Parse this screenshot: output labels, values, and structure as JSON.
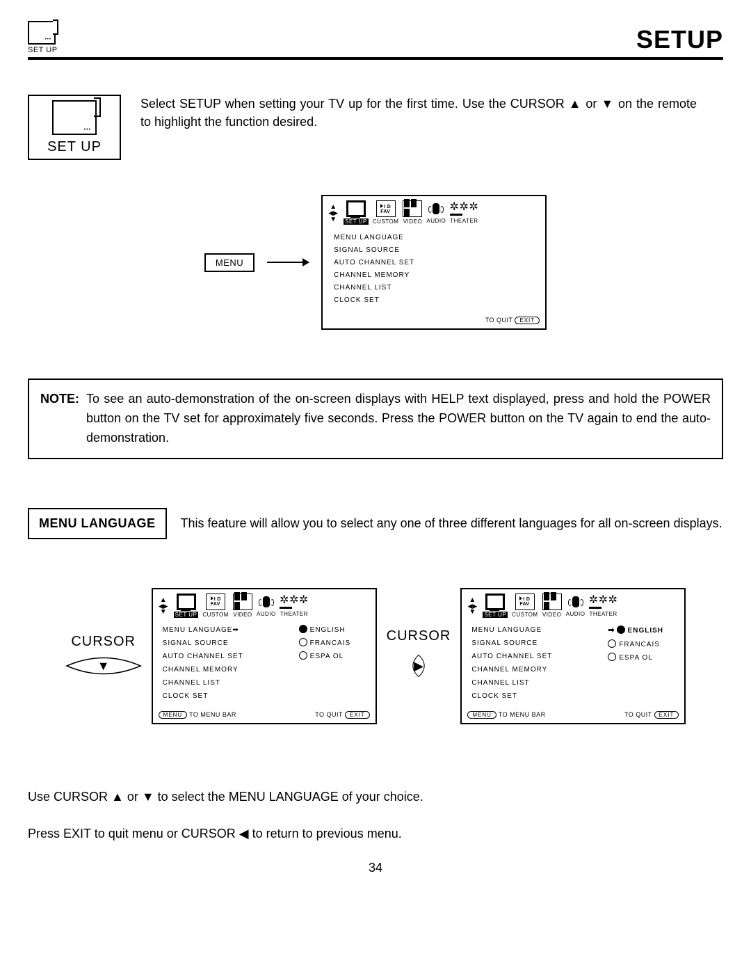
{
  "header": {
    "icon_caption": "SET UP",
    "title": "SETUP"
  },
  "setup_box": {
    "caption": "SET UP"
  },
  "intro_text": "Select SETUP when setting your TV up for the first time.  Use the CURSOR ▲ or ▼ on the remote to highlight the function desired.",
  "tabs": {
    "setup": "SET UP",
    "custom": "CUSTOM",
    "video": "VIDEO",
    "audio": "AUDIO",
    "theater": "THEATER",
    "fav_line1": "I D",
    "fav_line2": "FAV"
  },
  "menu_items": {
    "menu_language": "MENU LANGUAGE",
    "signal_source": "SIGNAL SOURCE",
    "auto_channel_set": "AUTO CHANNEL SET",
    "channel_memory": "CHANNEL MEMORY",
    "channel_list": "CHANNEL LIST",
    "clock_set": "CLOCK SET"
  },
  "menu_button": "MENU",
  "footer": {
    "to_menu_bar": "TO MENU BAR",
    "to_quit": "TO QUIT",
    "menu_chip": "MENU",
    "exit_chip": "EXIT"
  },
  "note": {
    "label": "NOTE:",
    "text": "To see an auto-demonstration of the on-screen displays with HELP text displayed, press and hold the POWER button on the TV set for approximately five seconds. Press the POWER button on the TV again to end the auto-demonstration."
  },
  "menu_language_section": {
    "label": "MENU LANGUAGE",
    "text": "This feature will allow you to select any one of three different languages for all on-screen displays."
  },
  "languages": {
    "english": "ENGLISH",
    "francais": "FRANCAIS",
    "espanol": "ESPA OL"
  },
  "cursor_label": "CURSOR",
  "bottom_p1": "Use CURSOR ▲ or ▼ to select the MENU LANGUAGE of your choice.",
  "bottom_p2": "Press EXIT to quit menu or CURSOR ◀ to return to previous menu.",
  "page_number": "34"
}
